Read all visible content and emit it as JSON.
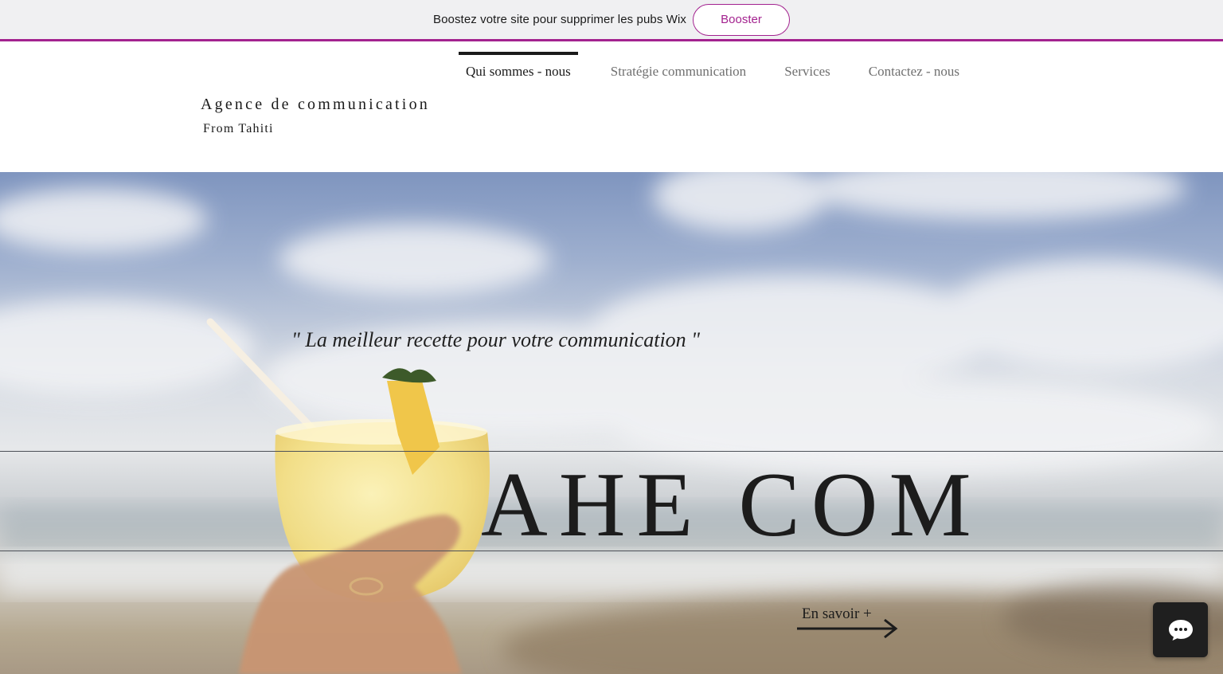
{
  "promo": {
    "text": "Boostez votre site pour supprimer les pubs Wix",
    "button_label": "Booster",
    "accent_color": "#a3228f"
  },
  "nav": {
    "items": [
      {
        "label": "Qui sommes - nous",
        "active": true
      },
      {
        "label": "Stratégie communication",
        "active": false
      },
      {
        "label": "Services",
        "active": false
      },
      {
        "label": "Contactez - nous",
        "active": false
      }
    ]
  },
  "brand": {
    "title": "Agence de communication",
    "subtitle": "From Tahiti"
  },
  "hero": {
    "quote": "\" La meilleur recette pour votre communication \"",
    "title": "AHE COM",
    "cta_label": "En savoir +",
    "cta_icon": "arrow-right-icon"
  },
  "chat": {
    "icon": "chat-bubble-icon"
  }
}
